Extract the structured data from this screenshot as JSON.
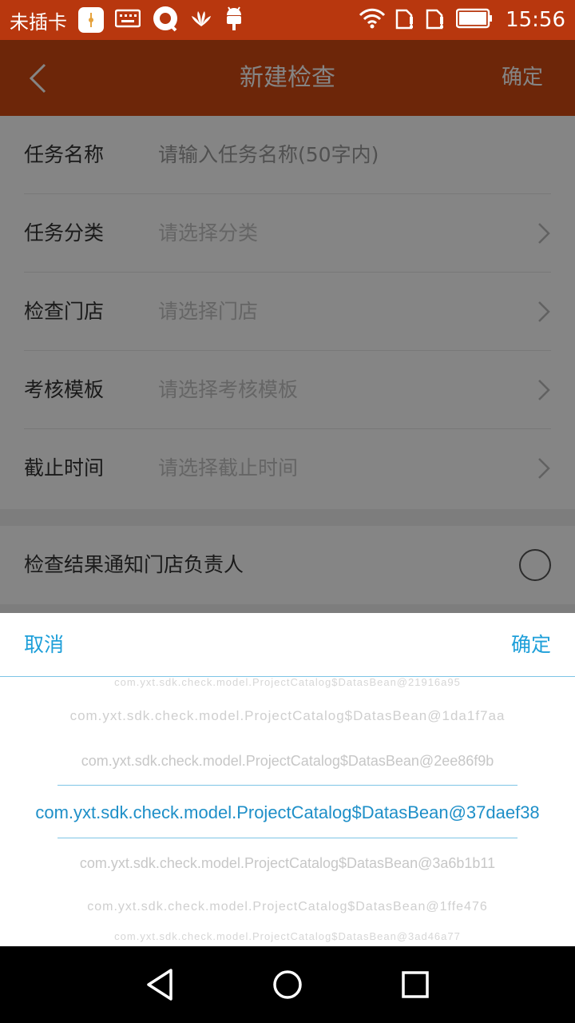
{
  "status_bar": {
    "carrier": "未插卡",
    "time": "15:56",
    "icons": [
      "app-notification-icon",
      "keyboard-icon",
      "chat-icon",
      "huawei-icon",
      "android-icon",
      "wifi-icon",
      "sim-alert-icon",
      "sim-alert-icon",
      "battery-icon"
    ]
  },
  "app_bar": {
    "title": "新建检查",
    "confirm": "确定",
    "back_icon": "chevron-left-icon"
  },
  "form": {
    "rows": [
      {
        "label": "任务名称",
        "value": "请输入任务名称(50字内)"
      },
      {
        "label": "任务分类",
        "value": "请选择分类"
      },
      {
        "label": "检查门店",
        "value": "请选择门店"
      },
      {
        "label": "考核模板",
        "value": "请选择考核模板"
      },
      {
        "label": "截止时间",
        "value": "请选择截止时间"
      }
    ],
    "notify_label": "检查结果通知门店负责人"
  },
  "picker": {
    "cancel": "取消",
    "confirm": "确定",
    "options": [
      "com.yxt.sdk.check.model.ProjectCatalog$DatasBean@21916a95",
      "com.yxt.sdk.check.model.ProjectCatalog$DatasBean@1da1f7aa",
      "com.yxt.sdk.check.model.ProjectCatalog$DatasBean@2ee86f9b",
      "com.yxt.sdk.check.model.ProjectCatalog$DatasBean@37daef38",
      "com.yxt.sdk.check.model.ProjectCatalog$DatasBean@3a6b1b11",
      "com.yxt.sdk.check.model.ProjectCatalog$DatasBean@1ffe476",
      "com.yxt.sdk.check.model.ProjectCatalog$DatasBean@3ad46a77"
    ],
    "selected_index": 3
  },
  "colors": {
    "accent": "#d24a12",
    "picker_blue": "#1e9fd9"
  },
  "nav_bar": {
    "icons": [
      "back-triangle-icon",
      "home-circle-icon",
      "recents-square-icon"
    ]
  }
}
